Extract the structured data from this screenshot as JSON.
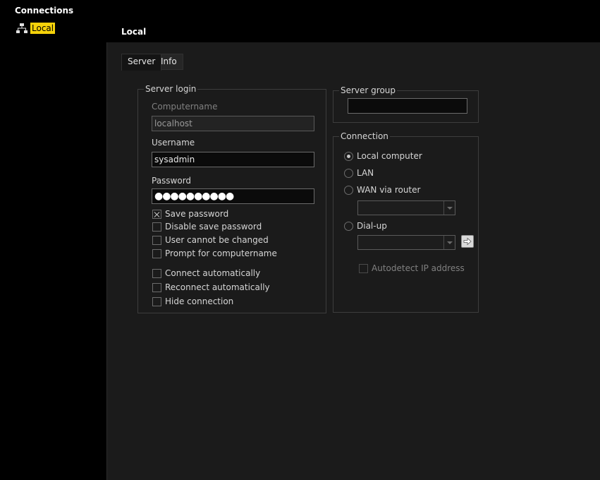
{
  "tree": {
    "title": "Connections",
    "items": [
      {
        "label": "Local",
        "icon": "network-icon",
        "selected": true
      }
    ]
  },
  "header": {
    "title": "Local"
  },
  "tabs": [
    {
      "label": "Server",
      "active": true
    },
    {
      "label": "Info",
      "active": false
    }
  ],
  "server_login": {
    "title": "Server login",
    "computername_label": "Computername",
    "computername_value": "localhost",
    "username_label": "Username",
    "username_value": "sysadmin",
    "password_label": "Password",
    "password_value": "●●●●●●●●●●",
    "checkboxes": [
      {
        "label": "Save password",
        "checked": true
      },
      {
        "label": "Disable save password",
        "checked": false
      },
      {
        "label": "User cannot be changed",
        "checked": false
      },
      {
        "label": "Prompt for computername",
        "checked": false
      },
      {
        "label": "Connect automatically",
        "checked": false
      },
      {
        "label": "Reconnect automatically",
        "checked": false
      },
      {
        "label": "Hide connection",
        "checked": false
      }
    ]
  },
  "server_group": {
    "title": "Server group",
    "value": ""
  },
  "connection": {
    "title": "Connection",
    "options": [
      {
        "label": "Local computer",
        "selected": true
      },
      {
        "label": "LAN",
        "selected": false
      },
      {
        "label": "WAN via router",
        "selected": false
      },
      {
        "label": "Dial-up",
        "selected": false
      }
    ],
    "wan_combo_value": "",
    "dialup_combo_value": "",
    "autodetect_label": "Autodetect IP address",
    "autodetect_checked": false
  },
  "colors": {
    "selection": "#f5d20a",
    "pane_bg": "#1b1b1b",
    "background": "#000000"
  }
}
